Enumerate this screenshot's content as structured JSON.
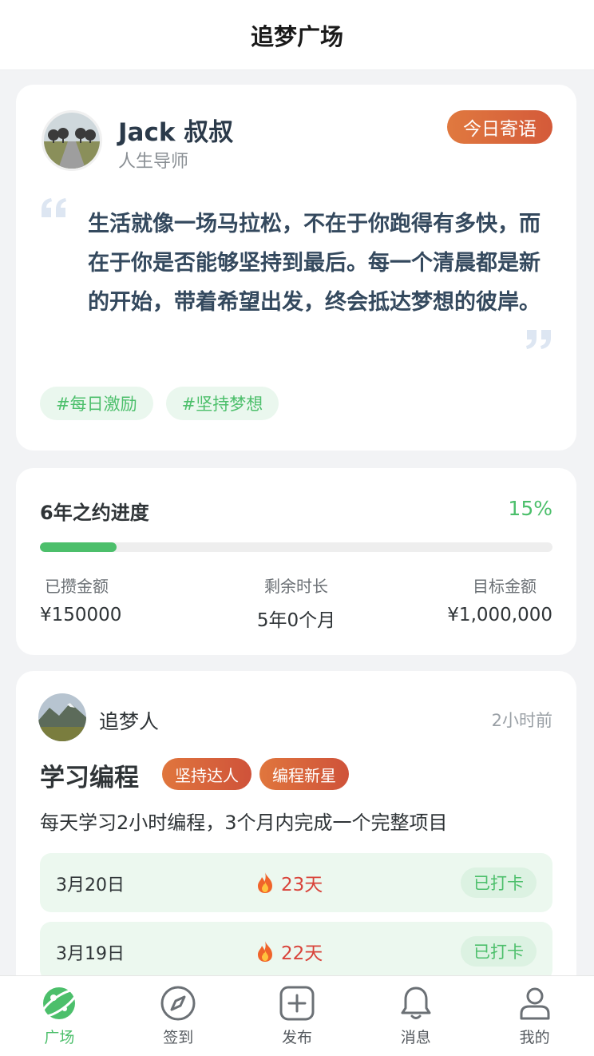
{
  "header": {
    "title": "追梦广场"
  },
  "quote_card": {
    "mentor_name": "Jack 叔叔",
    "mentor_role": "人生导师",
    "badge": "今日寄语",
    "quote": "生活就像一场马拉松，不在于你跑得有多快，而在于你是否能够坚持到最后。每一个清晨都是新的开始，带着希望出发，终会抵达梦想的彼岸。",
    "tags": [
      "#每日激励",
      "#坚持梦想"
    ]
  },
  "progress_card": {
    "title": "6年之约进度",
    "percent_label": "15%",
    "progress_fraction": 0.15,
    "saved_label": "已攒金额",
    "saved_value": "¥150000",
    "remaining_label": "剩余时长",
    "remaining_value": "5年0个月",
    "target_label": "目标金额",
    "target_value": "¥1,000,000"
  },
  "post_card": {
    "user_name": "追梦人",
    "time": "2小时前",
    "title": "学习编程",
    "badges": [
      "坚持达人",
      "编程新星"
    ],
    "description": "每天学习2小时编程，3个月内完成一个完整项目",
    "checkins": [
      {
        "date": "3月20日",
        "streak": "23天",
        "status": "已打卡"
      },
      {
        "date": "3月19日",
        "streak": "22天",
        "status": "已打卡"
      }
    ]
  },
  "tabbar": {
    "items": [
      {
        "label": "广场",
        "icon": "planet-icon",
        "active": true
      },
      {
        "label": "签到",
        "icon": "compass-icon",
        "active": false
      },
      {
        "label": "发布",
        "icon": "plus-square-icon",
        "active": false
      },
      {
        "label": "消息",
        "icon": "bell-icon",
        "active": false
      },
      {
        "label": "我的",
        "icon": "user-icon",
        "active": false
      }
    ]
  },
  "colors": {
    "accent_green": "#4cbf6b",
    "badge_orange": "#e0793f",
    "streak_red": "#d9433a"
  }
}
